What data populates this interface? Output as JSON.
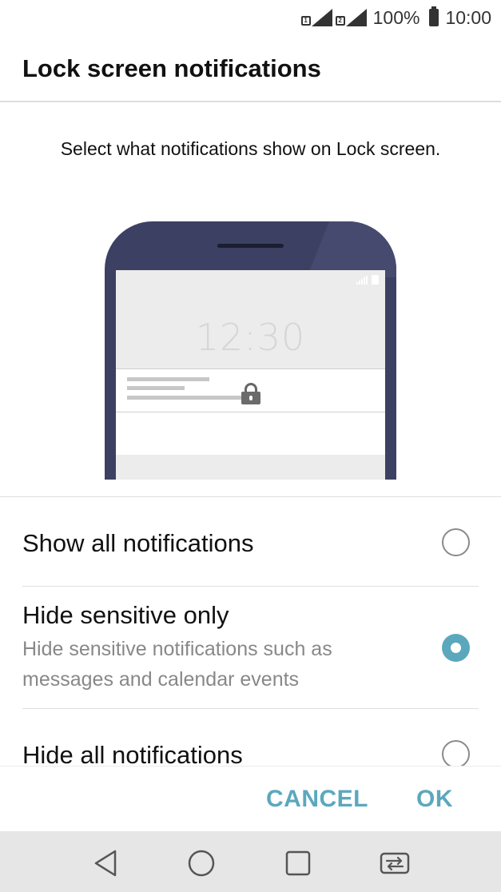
{
  "status_bar": {
    "sim1": "1",
    "sim2": "2",
    "battery_percent": "100%",
    "time": "10:00"
  },
  "dialog": {
    "title": "Lock screen notifications",
    "description": "Select what notifications show on Lock screen.",
    "preview": {
      "clock": "12:30"
    },
    "options": [
      {
        "label": "Show all notifications",
        "selected": false
      },
      {
        "label": "Hide sensitive only",
        "sublabel": "Hide sensitive notifications such as messages and calendar events",
        "selected": true
      },
      {
        "label": "Hide all notifications",
        "selected": false
      }
    ],
    "buttons": {
      "cancel": "CANCEL",
      "ok": "OK"
    },
    "accent_color": "#5ba8bd"
  },
  "nav_bar": {
    "icons": [
      "back-icon",
      "home-icon",
      "recents-icon",
      "dual-window-icon"
    ]
  }
}
